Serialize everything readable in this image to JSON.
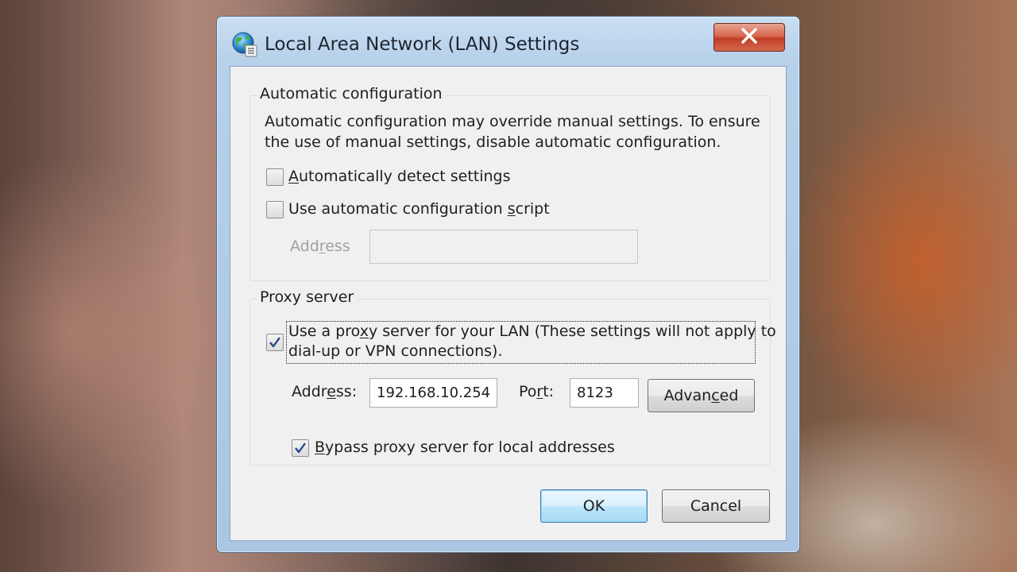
{
  "window": {
    "title": "Local Area Network (LAN) Settings",
    "icon": "globe-settings-icon",
    "close_label": "✕"
  },
  "automatic_configuration": {
    "group_title": "Automatic configuration",
    "description_line1": "Automatic configuration may override manual settings.  To ensure",
    "description_line2": "the use of manual settings, disable automatic configuration.",
    "auto_detect": {
      "pre": "",
      "accel": "A",
      "post": "utomatically detect settings",
      "checked": false
    },
    "use_script": {
      "pre": "Use automatic configuration ",
      "accel": "s",
      "post": "cript",
      "checked": false
    },
    "address_label": {
      "pre": "Add",
      "accel": "r",
      "post": "ess"
    },
    "address_value": ""
  },
  "proxy_server": {
    "group_title": "Proxy server",
    "use_proxy": {
      "pre": "Use a pro",
      "accel": "x",
      "post": "y server for your LAN (These settings will not apply to",
      "line2": "dial-up or VPN connections).",
      "checked": true
    },
    "address_label": {
      "pre": "Addr",
      "accel": "e",
      "post": "ss:"
    },
    "address_value": "192.168.10.254",
    "port_label": {
      "pre": "Po",
      "accel": "r",
      "post": "t:"
    },
    "port_value": "8123",
    "advanced_label": {
      "pre": "Advan",
      "accel": "c",
      "post": "ed"
    },
    "bypass": {
      "pre": "",
      "accel": "B",
      "post": "ypass proxy server for local addresses",
      "checked": true
    }
  },
  "buttons": {
    "ok": "OK",
    "cancel": "Cancel"
  },
  "colors": {
    "title_bar": "#b7d1ea",
    "close_button": "#c13d26",
    "default_button": "#bee6fd",
    "dialog_face": "#f0f0f0"
  }
}
